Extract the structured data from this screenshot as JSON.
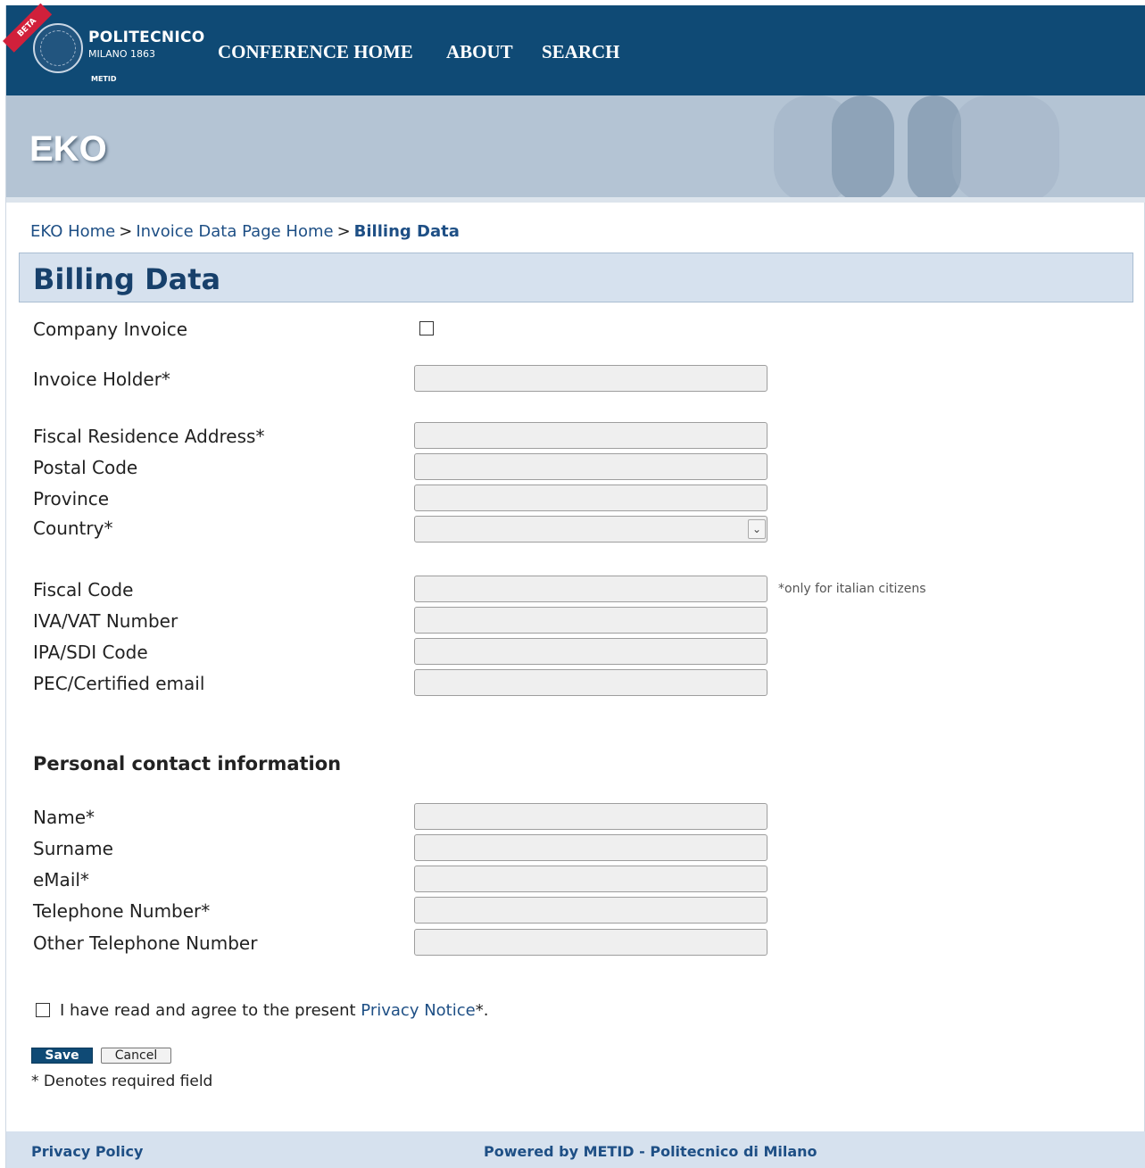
{
  "header": {
    "beta_badge": "BETA",
    "logo_name": "POLITECNICO",
    "logo_sub": "MILANO 1863",
    "logo_metid": "METID",
    "nav": [
      {
        "label": "CONFERENCE HOME"
      },
      {
        "label": "ABOUT"
      },
      {
        "label": "SEARCH"
      }
    ]
  },
  "banner": {
    "title": "EKO"
  },
  "breadcrumb": {
    "items": [
      "EKO Home",
      "Invoice Data Page Home"
    ],
    "separator": ">",
    "current": "Billing Data"
  },
  "page": {
    "title": "Billing Data"
  },
  "form": {
    "company_invoice_label": "Company Invoice",
    "invoice_holder_label": "Invoice Holder*",
    "fiscal_address_label": "Fiscal Residence Address*",
    "postal_code_label": "Postal Code",
    "province_label": "Province",
    "country_label": "Country*",
    "fiscal_code_label": "Fiscal Code",
    "fiscal_code_note": "*only for italian citizens",
    "vat_label": "IVA/VAT Number",
    "ipa_label": "IPA/SDI Code",
    "pec_label": "PEC/Certified email",
    "contact_heading": "Personal contact information",
    "name_label": "Name*",
    "surname_label": "Surname",
    "email_label": "eMail*",
    "telephone_label": "Telephone Number*",
    "other_telephone_label": "Other Telephone Number",
    "privacy_text_before": "I have read and agree to the present ",
    "privacy_link": "Privacy Notice",
    "privacy_text_after": "*.",
    "save_label": "Save",
    "cancel_label": "Cancel",
    "required_note": "* Denotes required field"
  },
  "footer": {
    "privacy_policy": "Privacy Policy",
    "powered_by": "Powered by METID - Politecnico di Milano"
  }
}
